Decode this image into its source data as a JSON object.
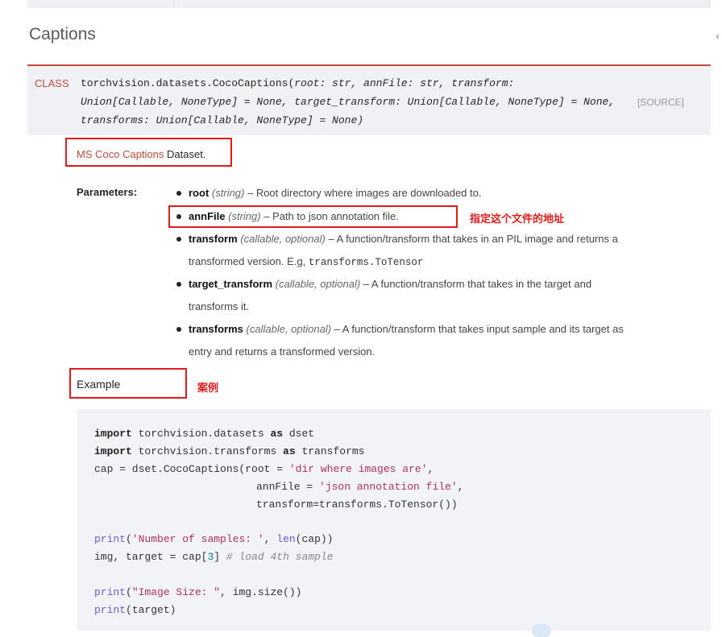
{
  "section_title": "Captions",
  "signature": {
    "class_tag": "CLASS",
    "line1_name": "torchvision.datasets.CocoCaptions(",
    "line1_params": "root: str, annFile: str, transform:",
    "line2": "Union[Callable, NoneType] = None, target_transform: Union[Callable, NoneType] = None,",
    "line3": "transforms: Union[Callable, NoneType] = None)",
    "source_label": "[SOURCE]"
  },
  "description": {
    "link_text": "MS Coco Captions",
    "suffix": " Dataset."
  },
  "parameters": {
    "label": "Parameters:",
    "items": [
      {
        "name": "root",
        "type": "(string)",
        "desc": " – Root directory where images are downloaded to."
      },
      {
        "name": "annFile",
        "type": "(string)",
        "desc": " – Path to json annotation file."
      },
      {
        "name": "transform",
        "type": "(callable, optional)",
        "desc": " – A function/transform that takes in an PIL image and returns a",
        "cont": "transformed version. E.g, ",
        "code": "transforms.ToTensor"
      },
      {
        "name": "target_transform",
        "type": "(callable, optional)",
        "desc": " – A function/transform that takes in the target and",
        "cont": "transforms it."
      },
      {
        "name": "transforms",
        "type": "(callable, optional)",
        "desc": " – A function/transform that takes input sample and its target as",
        "cont": "entry and returns a transformed version."
      }
    ]
  },
  "annotations": {
    "annfile_note": "指定这个文件的地址",
    "example_note": "案例"
  },
  "example_label": "Example",
  "code": {
    "l1": {
      "kw1": "import",
      "mod": " torchvision.datasets ",
      "kw2": "as",
      "alias": " dset"
    },
    "l2": {
      "kw1": "import",
      "mod": " torchvision.transforms ",
      "kw2": "as",
      "alias": " transforms"
    },
    "l3": {
      "a": "cap = dset.CocoCaptions(root = ",
      "s": "'dir where images are'",
      "b": ","
    },
    "l4": {
      "a": "annFile = ",
      "s": "'json annotation file'",
      "b": ","
    },
    "l5": "transform=transforms.ToTensor())",
    "l6": {
      "f": "print",
      "a": "(",
      "s": "'Number of samples: '",
      "b": ", ",
      "f2": "len",
      "c": "(cap))"
    },
    "l7": {
      "a": "img, target = cap[",
      "n": "3",
      "b": "] ",
      "com": "# load 4th sample"
    },
    "l8": {
      "f": "print",
      "a": "(",
      "s": "\"Image Size: \"",
      "b": ", img.size())"
    },
    "l9": {
      "f": "print",
      "a": "(target)"
    }
  }
}
